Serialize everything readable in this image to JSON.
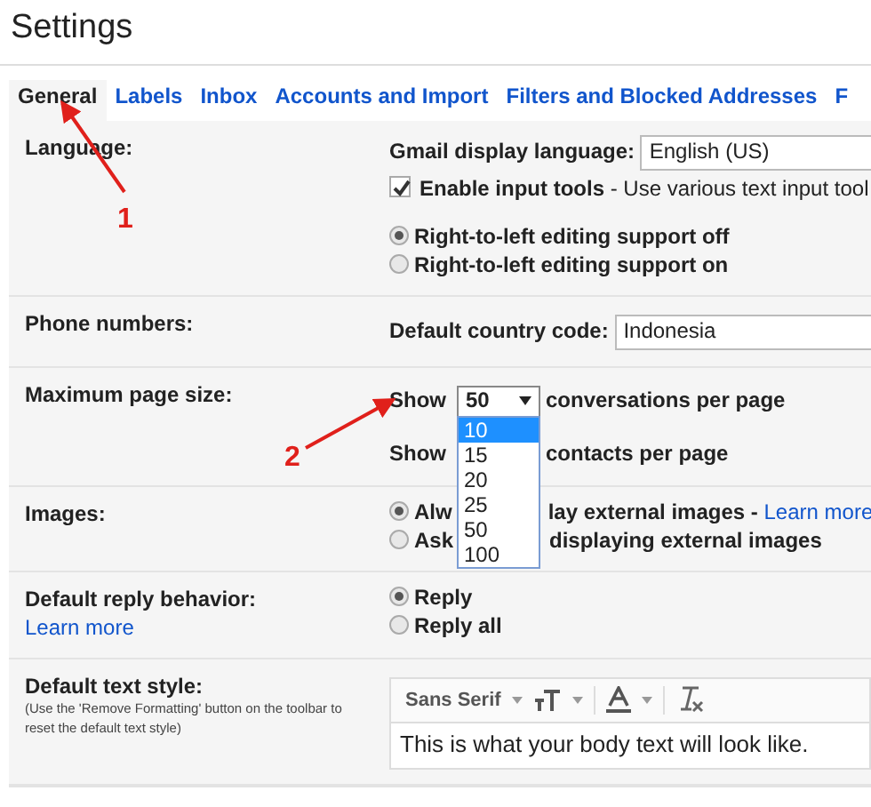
{
  "window": {
    "title": "Settings"
  },
  "tabs": [
    {
      "label": "General",
      "selected": true
    },
    {
      "label": "Labels",
      "selected": false
    },
    {
      "label": "Inbox",
      "selected": false
    },
    {
      "label": "Accounts and Import",
      "selected": false
    },
    {
      "label": "Filters and Blocked Addresses",
      "selected": false
    },
    {
      "label": "F",
      "selected": false
    }
  ],
  "language": {
    "label": "Language:",
    "display_language_label": "Gmail display language:",
    "display_language": "English (US)",
    "input_tools": {
      "checked": true,
      "text": "**Enable input tools** - Use various text input tool"
    },
    "rtl_options": [
      {
        "label": "Right-to-left editing support off",
        "selected": true
      },
      {
        "label": "Right-to-left editing support on",
        "selected": false
      }
    ]
  },
  "phone": {
    "label": "Phone numbers:",
    "country_label": "Default country code:",
    "country": "Indonesia"
  },
  "page_size": {
    "label": "Maximum page size:",
    "rows": [
      {
        "prefix": "Show",
        "value": "50",
        "suffix": "conversations per page"
      },
      {
        "prefix": "Show",
        "suffix": "contacts per page"
      }
    ],
    "dropdown": [
      {
        "label": "10",
        "selected": true
      },
      {
        "label": "15",
        "selected": false
      },
      {
        "label": "20",
        "selected": false
      },
      {
        "label": "25",
        "selected": false
      },
      {
        "label": "50",
        "selected": false
      },
      {
        "label": "100",
        "selected": false
      }
    ]
  },
  "images": {
    "label": "Images:",
    "options": [
      {
        "selected": true,
        "before": "Alw",
        "after": "lay external images -",
        "link": "Learn more"
      },
      {
        "selected": false,
        "before": "Ask",
        "after": "displaying external images"
      }
    ]
  },
  "reply": {
    "label": "Default reply behavior:",
    "link": "Learn more",
    "options": [
      {
        "label": "Reply",
        "selected": true
      },
      {
        "label": "Reply all",
        "selected": false
      }
    ]
  },
  "text_style": {
    "label": "Default text style:",
    "note": "(Use the 'Remove Formatting' button on the toolbar to reset the default text style)",
    "font": "Sans Serif",
    "sample": "This is what your body text will look like."
  },
  "annotations": [
    {
      "label": "1"
    },
    {
      "label": "2"
    }
  ]
}
